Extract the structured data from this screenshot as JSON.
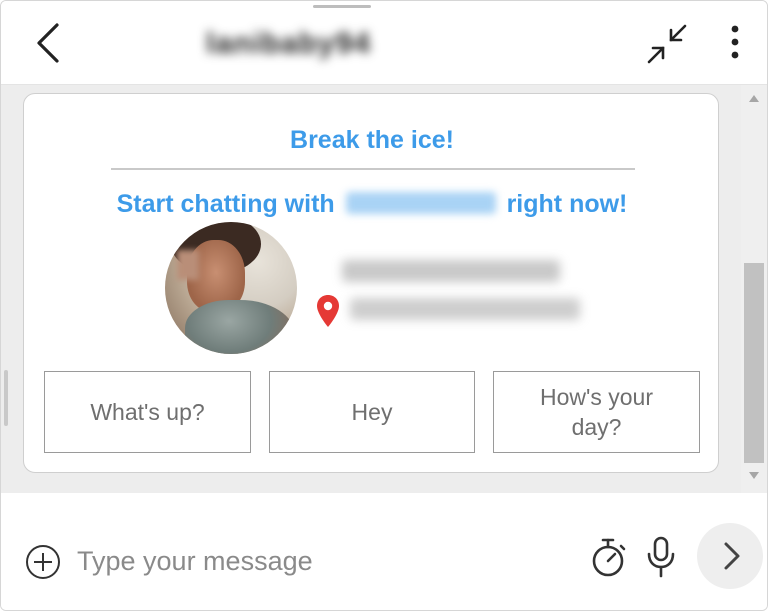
{
  "header": {
    "contact_name": "lanibaby94",
    "icons": {
      "back": "chevron-left-icon",
      "minimize": "minimize-arrows-icon",
      "menu": "vertical-dots-icon"
    }
  },
  "card": {
    "title": "Break the ice!",
    "subtitle_prefix": "Start chatting with",
    "subtitle_suffix": "right now!",
    "quick_replies": [
      "What's up?",
      "Hey",
      "How's your day?"
    ]
  },
  "composer": {
    "placeholder": "Type your message",
    "icons": {
      "add": "plus-circle-icon",
      "timer": "stopwatch-icon",
      "mic": "microphone-icon",
      "send": "chevron-right-icon"
    }
  },
  "colors": {
    "accent": "#3d9be9",
    "pin": "#e53935",
    "chat_background": "#ededed"
  }
}
